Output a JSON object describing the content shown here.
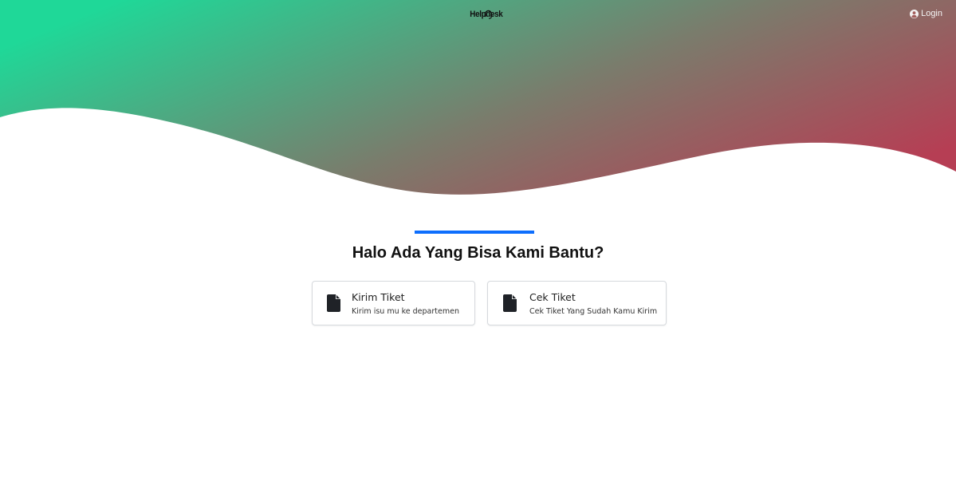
{
  "header": {
    "logo_text": "Helpdesk",
    "login_label": "Login"
  },
  "colors": {
    "gradient_start": "#1fd898",
    "gradient_end": "#b63e54",
    "accent": "#0d6efd"
  },
  "main": {
    "headline": "Halo Ada Yang Bisa Kami Bantu?",
    "cards": [
      {
        "title": "Kirim Tiket",
        "description": "Kirim isu mu ke departemen",
        "icon": "file-icon"
      },
      {
        "title": "Cek Tiket",
        "description": "Cek Tiket Yang Sudah Kamu Kirim",
        "icon": "file-icon"
      }
    ]
  }
}
